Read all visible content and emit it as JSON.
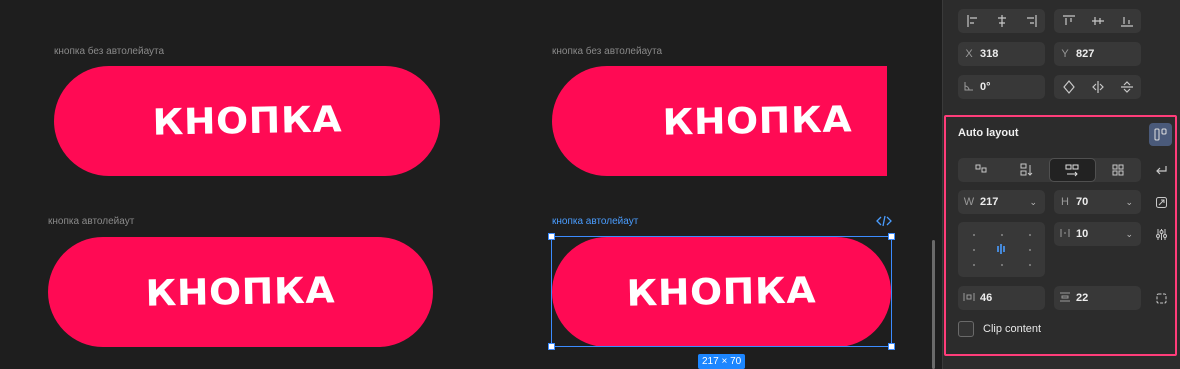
{
  "canvas": {
    "frames": [
      {
        "label": "кнопка без автолейаута",
        "button_text": "КНОПКА"
      },
      {
        "label": "кнопка без автолейаута",
        "button_text": "КНОПКА"
      },
      {
        "label": "кнопка автолейаут",
        "button_text": "КНОПКА"
      },
      {
        "label": "кнопка автолейаут",
        "button_text": "КНОПКА"
      }
    ],
    "selection_size": "217 × 70",
    "button_color": "#ff0a54",
    "selection_color": "#3b8cff"
  },
  "panel": {
    "position": {
      "x_label": "X",
      "x_value": "318",
      "y_label": "Y",
      "y_value": "827",
      "rotation_value": "0°"
    },
    "auto_layout": {
      "title": "Auto layout",
      "width_label": "W",
      "width_value": "217",
      "height_label": "H",
      "height_value": "70",
      "gap_value": "10",
      "horizontal_padding": "46",
      "vertical_padding": "22",
      "clip_content_label": "Clip content",
      "clip_content_checked": false,
      "direction_selected": "horizontal",
      "accent_color": "#ff3d7a"
    }
  }
}
